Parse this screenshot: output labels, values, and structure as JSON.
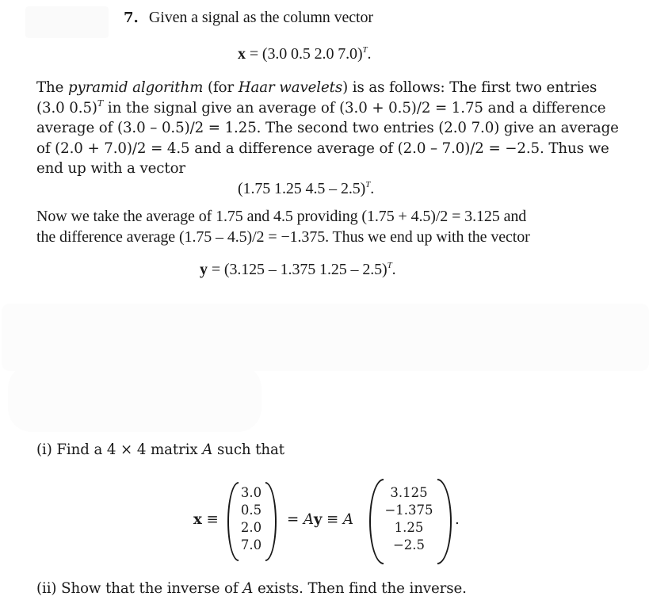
{
  "problem": {
    "number": "7.",
    "intro": "Given a signal as the column vector",
    "x_eq": {
      "lhs": "x",
      "rhs": "= (3.0  0.5  2.0  7.0)",
      "sup": "T",
      "end": "."
    },
    "paragraph1": {
      "line1_a": "The ",
      "line1_italic1": "pyramid algorithm",
      "line1_b": " (for ",
      "line1_italic2": "Haar wavelets",
      "line1_c": ") is as follows: The first two entries",
      "line2_a": "(3.0  0.5)",
      "line2_sup": "T",
      "line2_b": " in the signal give an average of (3.0 + 0.5)/2 = 1.75 and a difference",
      "line3": "average of (3.0 – 0.5)/2 = 1.25.  The second two entries (2.0  7.0) give an average",
      "line4": "of (2.0 + 7.0)/2 = 4.5 and a difference average of (2.0 – 7.0)/2 = −2.5.  Thus we",
      "line5": "end up with a vector"
    },
    "mid_vector": {
      "text": "(1.75  1.25  4.5   – 2.5)",
      "sup": "T",
      "end": "."
    },
    "paragraph2": {
      "line1": "Now we take the average of 1.75 and 4.5 providing (1.75 + 4.5)/2 = 3.125 and",
      "line2": "the difference average (1.75 – 4.5)/2 = −1.375.  Thus we end up with the vector"
    },
    "y_eq": {
      "lhs": "y",
      "rhs": "= (3.125   – 1.375  1.25   – 2.5)",
      "sup": "T",
      "end": "."
    },
    "part_i": {
      "label": "(i) Find a 4 × 4 matrix ",
      "var": "A",
      "rest": " such that"
    },
    "matrix_eq": {
      "x_lhs": "x",
      "equiv1": "≡",
      "x_vector": [
        "3.0",
        "0.5",
        "2.0",
        "7.0"
      ],
      "middle_a": "= ",
      "middle_A": "A",
      "middle_y": "y",
      "middle_b": " ≡ ",
      "A": "A",
      "y_vector": [
        "3.125",
        "−1.375",
        "1.25",
        "−2.5"
      ],
      "end": "."
    },
    "part_ii": {
      "label": "(ii) Show that the inverse of ",
      "var": "A",
      "rest": " exists. Then find the inverse."
    }
  }
}
